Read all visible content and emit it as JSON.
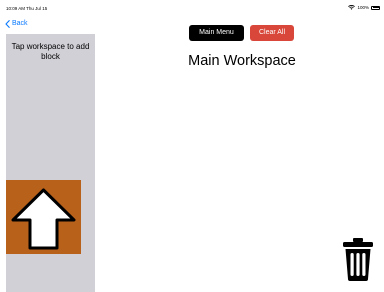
{
  "status_bar": {
    "time": "10:09 AM  Thu Jul 15",
    "battery": "100%"
  },
  "nav": {
    "back_label": "Back"
  },
  "sidebar": {
    "hint": "Tap workspace to add block",
    "blocks": [
      {
        "label": "up-arrow-block",
        "color": "#b8611a"
      }
    ]
  },
  "toolbar": {
    "main_menu_label": "Main Menu",
    "clear_all_label": "Clear All"
  },
  "workspace": {
    "title": "Main Workspace"
  },
  "colors": {
    "accent": "#0a7aff",
    "danger": "#d8473a",
    "sidebar_bg": "#d1d0d6",
    "block": "#b8611a"
  }
}
